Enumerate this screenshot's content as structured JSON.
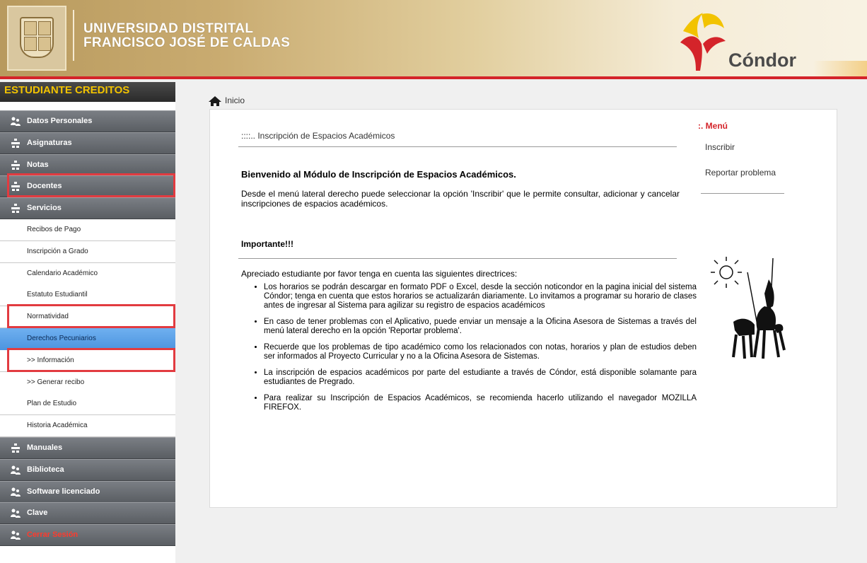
{
  "header": {
    "university_line1": "UNIVERSIDAD DISTRITAL",
    "university_line2": "FRANCISCO JOSÉ DE CALDAS",
    "app_name": "Cóndor",
    "brand_red": "#d4242a",
    "brand_yellow": "#f2c300"
  },
  "sidebar": {
    "title": "ESTUDIANTE CREDITOS",
    "items": [
      {
        "label": "Datos Personales",
        "type": "main",
        "icon": "user-group-icon"
      },
      {
        "label": "Asignaturas",
        "type": "main",
        "icon": "tree-icon"
      },
      {
        "label": "Notas",
        "type": "main",
        "icon": "tree-icon"
      },
      {
        "label": "Docentes",
        "type": "main",
        "icon": "tree-icon",
        "highlighted": true
      },
      {
        "label": "Servicios",
        "type": "main",
        "icon": "tree-icon"
      },
      {
        "label": "Recibos de Pago",
        "type": "sub"
      },
      {
        "label": "Inscripción a Grado",
        "type": "sub"
      },
      {
        "label": "Calendario Académico",
        "type": "sub"
      },
      {
        "label": "Estatuto Estudiantil",
        "type": "sub"
      },
      {
        "label": "Normatividad",
        "type": "sub",
        "highlighted": true
      },
      {
        "label": "Derechos Pecuniarios",
        "type": "sub",
        "active": true
      },
      {
        "label": ">> Información",
        "type": "sub",
        "highlighted": true
      },
      {
        "label": ">> Generar recibo",
        "type": "sub"
      },
      {
        "label": "Plan de Estudio",
        "type": "sub"
      },
      {
        "label": "Historia Académica",
        "type": "sub"
      },
      {
        "label": "Manuales",
        "type": "main",
        "icon": "tree-icon"
      },
      {
        "label": "Biblioteca",
        "type": "main",
        "icon": "user-group-icon"
      },
      {
        "label": "Software licenciado",
        "type": "main",
        "icon": "user-group-icon"
      },
      {
        "label": "Clave",
        "type": "main",
        "icon": "user-group-icon"
      },
      {
        "label": "Cerrar Sesión",
        "type": "main",
        "icon": "user-group-icon",
        "logout": true
      }
    ]
  },
  "breadcrumb": {
    "label": "Inicio",
    "icon": "home-icon"
  },
  "main": {
    "title": "::::.. Inscripción de Espacios Académicos",
    "welcome": "Bienvenido al Módulo de Inscripción de Espacios Académicos.",
    "intro": "Desde el menú lateral derecho puede seleccionar la opción 'Inscribir' que le permite consultar, adicionar y cancelar inscripciones de espacios académicos.",
    "important_title": "Importante!!!",
    "directrices": "Apreciado estudiante por favor tenga en cuenta las siguientes directrices:",
    "bullets": [
      "Los horarios se podrán descargar en formato PDF o Excel, desde la sección noticondor en la pagina inicial del sistema Cóndor; tenga en cuenta que estos horarios se actualizarán diariamente. Lo invitamos a programar su horario de clases antes de ingresar al Sistema para agilizar su registro de espacios académicos",
      "En caso de tener problemas con el Aplicativo, puede enviar un mensaje a la Oficina Asesora de Sistemas a través del menú lateral derecho en la opción 'Reportar problema'.",
      "Recuerde que los problemas de tipo académico como los relacionados con notas, horarios y plan de estudios deben ser informados al Proyecto Curricular y no a la Oficina Asesora de Sistemas.",
      "La inscripción de espacios académicos por parte del estudiante a través de Cóndor, está disponible solamante para estudiantes de Pregrado.",
      "Para realizar su Inscripción de Espacios Académicos, se recomienda hacerlo utilizando el navegador MOZILLA FIREFOX."
    ]
  },
  "right_menu": {
    "title": ":. Menú",
    "links": [
      "Inscribir",
      "Reportar problema"
    ]
  }
}
